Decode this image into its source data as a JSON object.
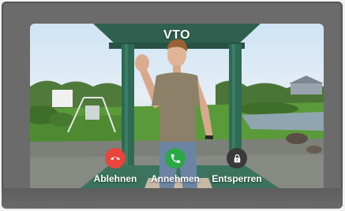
{
  "header": {
    "title": "VTO"
  },
  "actions": {
    "decline": {
      "label": "Ablehnen",
      "color": "#e8453c",
      "icon": "hang-up-icon"
    },
    "accept": {
      "label": "Annehmen",
      "color": "#2aa845",
      "icon": "phone-icon"
    },
    "unlock": {
      "label": "Entsperren",
      "color": "#3a3a3a",
      "icon": "lock-icon"
    }
  }
}
